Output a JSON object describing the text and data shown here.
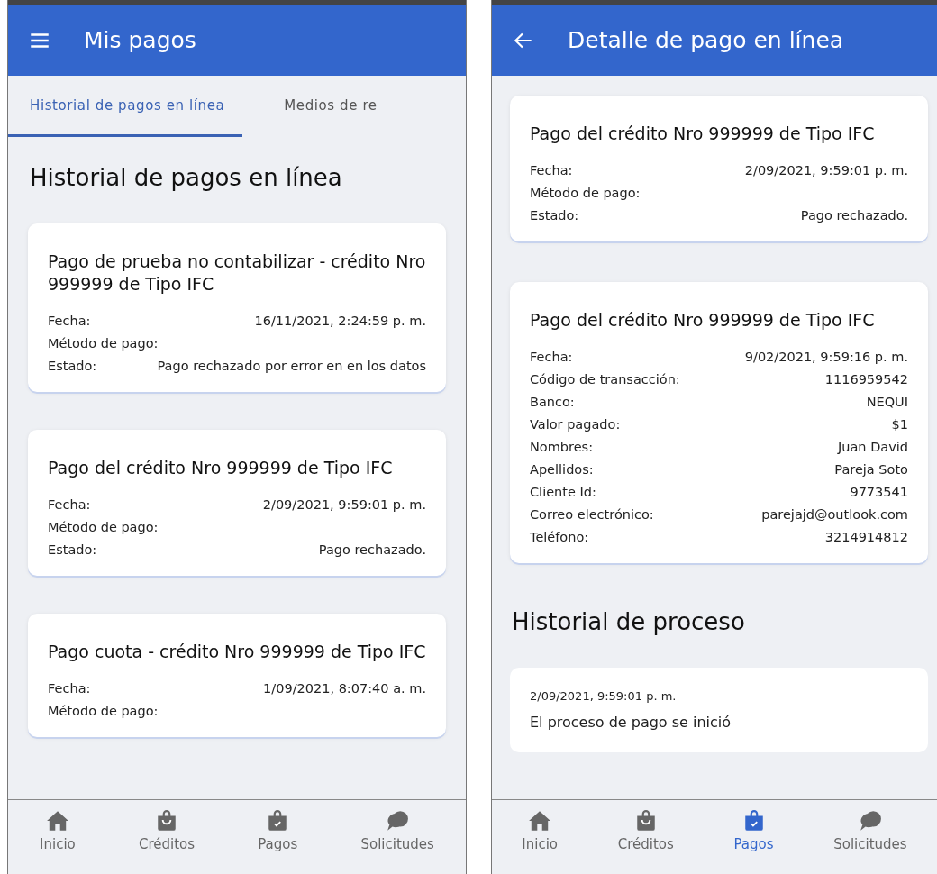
{
  "screens": [
    {
      "kind": "list",
      "header": {
        "title": "Mis pagos"
      },
      "tabs": [
        {
          "label": "Historial de pagos en línea",
          "selected": true
        },
        {
          "label": "Medios de re",
          "selected": false
        }
      ],
      "heading": "Historial de pagos en línea",
      "cards": [
        {
          "title": "Pago de prueba no contabilizar - crédito Nro 999999 de Tipo IFC",
          "fields": [
            {
              "label": "Fecha:",
              "value": "16/11/2021, 2:24:59 p. m."
            },
            {
              "label": "Método de pago:"
            },
            {
              "label": "Estado:",
              "value": "Pago rechazado por error en en los datos"
            }
          ]
        },
        {
          "title": "Pago del crédito Nro 999999 de Tipo IFC",
          "fields": [
            {
              "label": "Fecha:",
              "value": "2/09/2021, 9:59:01 p. m."
            },
            {
              "label": "Método de pago:"
            },
            {
              "label": "Estado:",
              "value": "Pago rechazado."
            }
          ]
        },
        {
          "title": "Pago cuota - crédito Nro 999999 de Tipo IFC",
          "fields": [
            {
              "label": "Fecha:",
              "value": "1/09/2021, 8:07:40 a. m."
            },
            {
              "label": "Método de pago:"
            }
          ]
        }
      ],
      "nav": [
        {
          "label": "Inicio",
          "selected": false
        },
        {
          "label": "Créditos",
          "selected": false
        },
        {
          "label": "Pagos",
          "selected": false
        },
        {
          "label": "Solicitudes",
          "selected": false
        }
      ]
    },
    {
      "kind": "detail",
      "header": {
        "title": "Detalle de pago en línea"
      },
      "cards": [
        {
          "title": "Pago del crédito Nro 999999 de Tipo IFC",
          "fields": [
            {
              "label": "Fecha:",
              "value": "2/09/2021, 9:59:01 p. m."
            },
            {
              "label": "Método de pago:"
            },
            {
              "label": "Estado:",
              "value": "Pago rechazado."
            }
          ]
        },
        {
          "title": "Pago del crédito Nro 999999 de Tipo IFC",
          "fields": [
            {
              "label": "Fecha:",
              "value": "9/02/2021, 9:59:16 p. m."
            },
            {
              "label": "Código de transacción:",
              "value": "1116959542"
            },
            {
              "label": "Banco:",
              "value": "NEQUI"
            },
            {
              "label": "Valor pagado:",
              "value": "$1"
            },
            {
              "label": "Nombres:",
              "value": "Juan David"
            },
            {
              "label": "Apellidos:",
              "value": "Pareja Soto"
            },
            {
              "label": "Cliente Id:",
              "value": "9773541"
            },
            {
              "label": "Correo electrónico:",
              "value": "parejajd@outlook.com"
            },
            {
              "label": "Teléfono:",
              "value": "3214914812"
            }
          ]
        }
      ],
      "section_heading": "Historial de proceso",
      "process": [
        {
          "time": "2/09/2021, 9:59:01 p. m.",
          "text": "El proceso de pago se inició"
        }
      ],
      "nav": [
        {
          "label": "Inicio",
          "selected": false
        },
        {
          "label": "Créditos",
          "selected": false
        },
        {
          "label": "Pagos",
          "selected": true
        },
        {
          "label": "Solicitudes",
          "selected": false
        }
      ]
    }
  ]
}
